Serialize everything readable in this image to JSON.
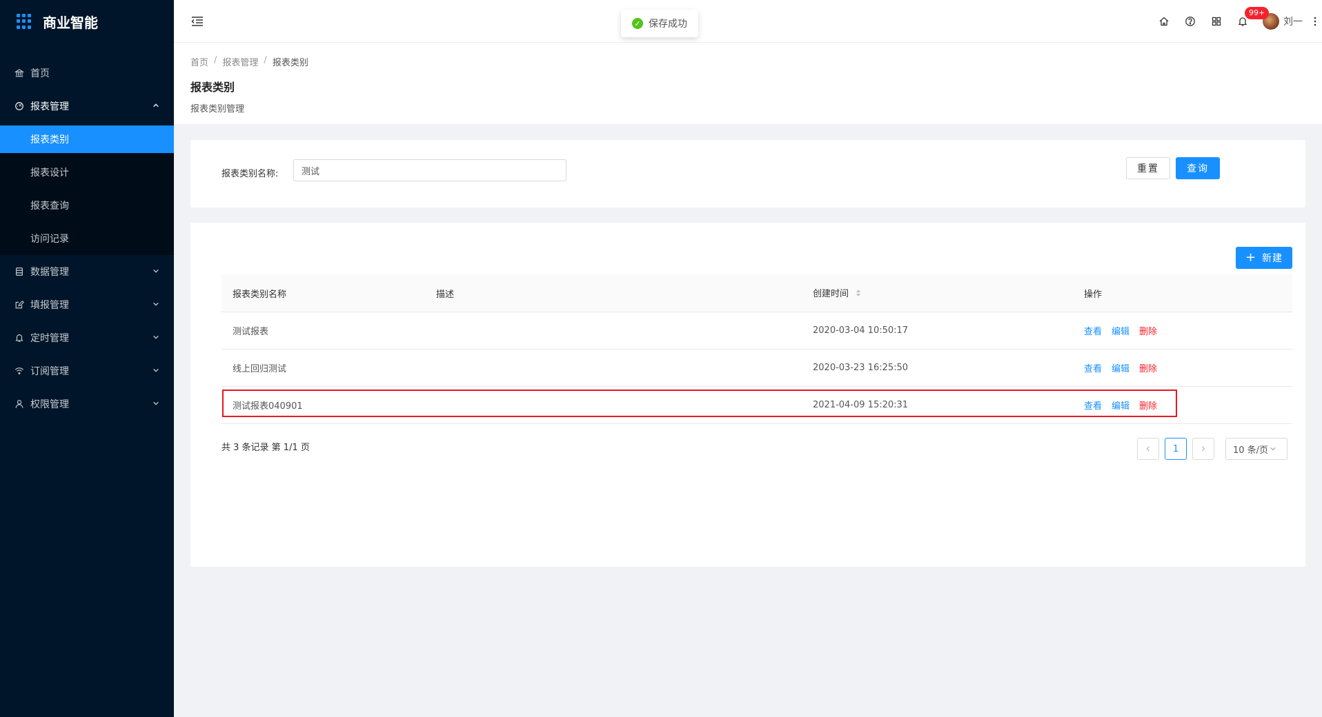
{
  "app": {
    "title": "商业智能"
  },
  "sidebar": {
    "items": [
      {
        "label": "首页",
        "icon": "bank-icon"
      },
      {
        "label": "报表管理",
        "icon": "dashboard-icon",
        "open": true,
        "children": [
          {
            "label": "报表类别",
            "active": true
          },
          {
            "label": "报表设计"
          },
          {
            "label": "报表查询"
          },
          {
            "label": "访问记录"
          }
        ]
      },
      {
        "label": "数据管理",
        "icon": "database-icon"
      },
      {
        "label": "填报管理",
        "icon": "edit-icon"
      },
      {
        "label": "定时管理",
        "icon": "bell-icon"
      },
      {
        "label": "订阅管理",
        "icon": "wifi-icon"
      },
      {
        "label": "权限管理",
        "icon": "user-icon"
      }
    ]
  },
  "header": {
    "toast": "保存成功",
    "badge": "99+",
    "user_name": "刘一"
  },
  "page": {
    "breadcrumb": [
      "首页",
      "报表管理",
      "报表类别"
    ],
    "title": "报表类别",
    "subtitle": "报表类别管理"
  },
  "search": {
    "label": "报表类别名称:",
    "value": "测试",
    "reset_label": "重置",
    "query_label": "查询"
  },
  "table": {
    "new_label": "新建",
    "columns": [
      "报表类别名称",
      "描述",
      "创建时间",
      "操作"
    ],
    "rows": [
      {
        "name": "测试报表",
        "desc": "",
        "time": "2020-03-04 10:50:17"
      },
      {
        "name": "线上回归测试",
        "desc": "",
        "time": "2020-03-23 16:25:50"
      },
      {
        "name": "测试报表040901",
        "desc": "",
        "time": "2021-04-09 15:20:31"
      }
    ],
    "actions": {
      "view": "查看",
      "edit": "编辑",
      "delete": "删除"
    }
  },
  "pagination": {
    "summary": "共 3 条记录 第 1/1 页",
    "current": "1",
    "page_size": "10 条/页"
  },
  "colors": {
    "primary": "#1890ff",
    "sidebar": "#001529",
    "danger": "#f5222d",
    "highlight": "#e8161d"
  }
}
